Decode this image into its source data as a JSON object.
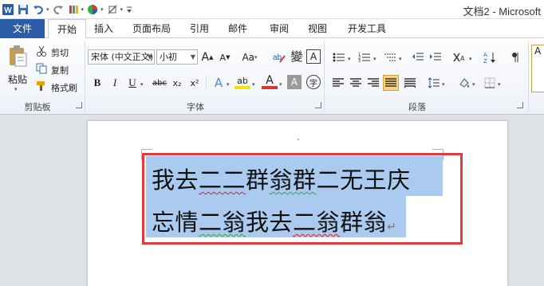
{
  "window": {
    "title": "文档2 - Microsoft"
  },
  "qat": {
    "icons": [
      "word-icon",
      "save-icon",
      "undo-icon",
      "redo-icon",
      "format-painter-icon",
      "color-icon",
      "clear-icon",
      "customize-icon"
    ]
  },
  "tabs": [
    {
      "label": "文件"
    },
    {
      "label": "开始"
    },
    {
      "label": "插入"
    },
    {
      "label": "页面布局"
    },
    {
      "label": "引用"
    },
    {
      "label": "邮件"
    },
    {
      "label": "审阅"
    },
    {
      "label": "视图"
    },
    {
      "label": "开发工具"
    }
  ],
  "clipboard": {
    "paste_label": "粘贴",
    "cut_label": "剪切",
    "copy_label": "复制",
    "format_painter_label": "格式刷",
    "group_label": "剪贴板"
  },
  "font": {
    "font_name": "宋体 (中文正文)",
    "font_size": "小初",
    "grow": "A",
    "shrink": "A",
    "change_case": "Aa",
    "bold": "B",
    "italic": "I",
    "underline": "U",
    "strike": "abc",
    "subscript": "x₂",
    "superscript": "x²",
    "text_effect": "A",
    "highlight": "ab",
    "font_color": "A",
    "char_shading": "A",
    "enclose": "字",
    "phonetic": "變",
    "border_char": "A",
    "group_label": "字体"
  },
  "paragraph": {
    "group_label": "段落"
  },
  "document": {
    "line1": [
      "我去",
      "二二",
      "群",
      "翁群",
      "二无王庆"
    ],
    "line2": [
      "忘情",
      "二翁",
      "我去",
      "二翁",
      "群翁"
    ],
    "para_mark": "↵"
  },
  "colors": {
    "file_tab": "#2a5ca8",
    "selection": "#aacbef",
    "highlight_box": "#e23b3b",
    "ribbon_active": "#f9d27a"
  }
}
